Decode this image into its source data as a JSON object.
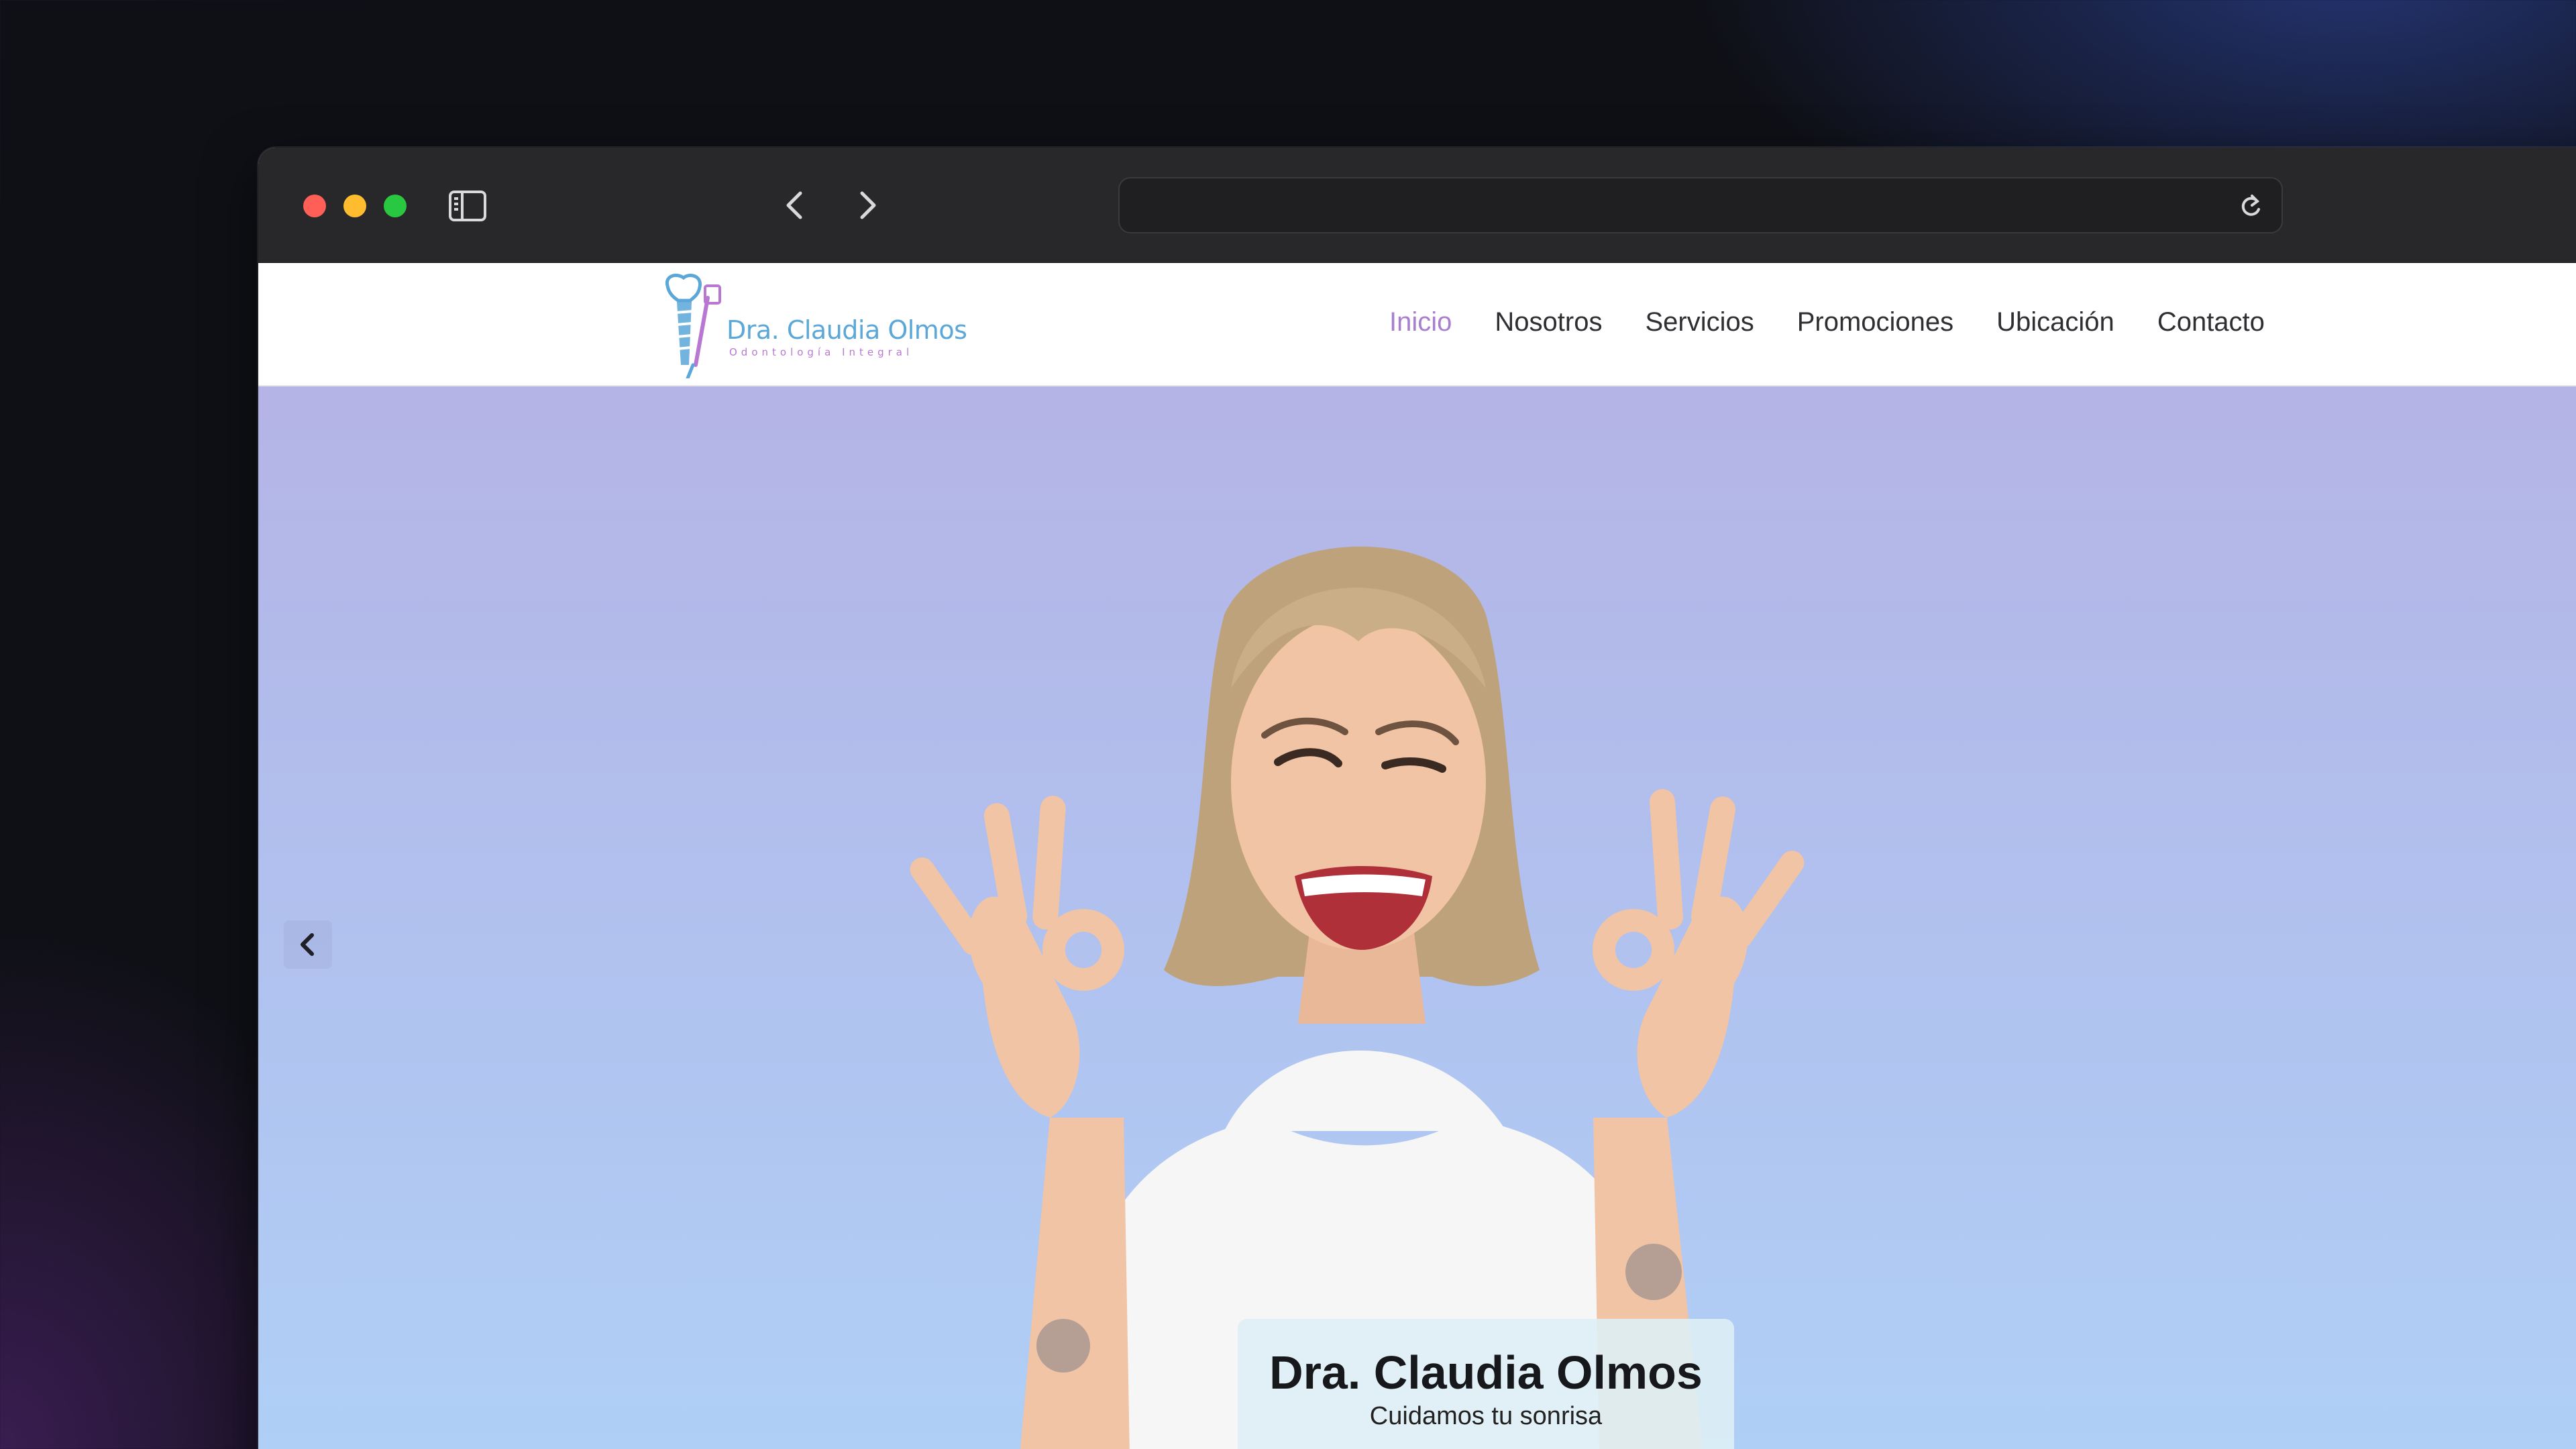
{
  "site": {
    "logo": {
      "name": "Dra. Claudia Olmos",
      "tagline": "Odontología Integral"
    },
    "nav": [
      {
        "label": "Inicio",
        "active": true
      },
      {
        "label": "Nosotros",
        "active": false
      },
      {
        "label": "Servicios",
        "active": false
      },
      {
        "label": "Promociones",
        "active": false
      },
      {
        "label": "Ubicación",
        "active": false
      },
      {
        "label": "Contacto",
        "active": false
      }
    ],
    "hero": {
      "title": "Dra. Claudia Olmos",
      "subtitle": "Cuidamos tu sonrisa"
    }
  },
  "browser": {
    "address": "",
    "icons": [
      "sidebar-icon",
      "back-icon",
      "forward-icon",
      "reload-icon"
    ]
  },
  "colors": {
    "nav_active": "#a77fce",
    "nav_text": "#2f2f33",
    "hero_top": "#b4b4e6",
    "hero_bottom": "#afd0f7",
    "logo_blue": "#5aa7d8",
    "logo_purple": "#b878d2"
  }
}
